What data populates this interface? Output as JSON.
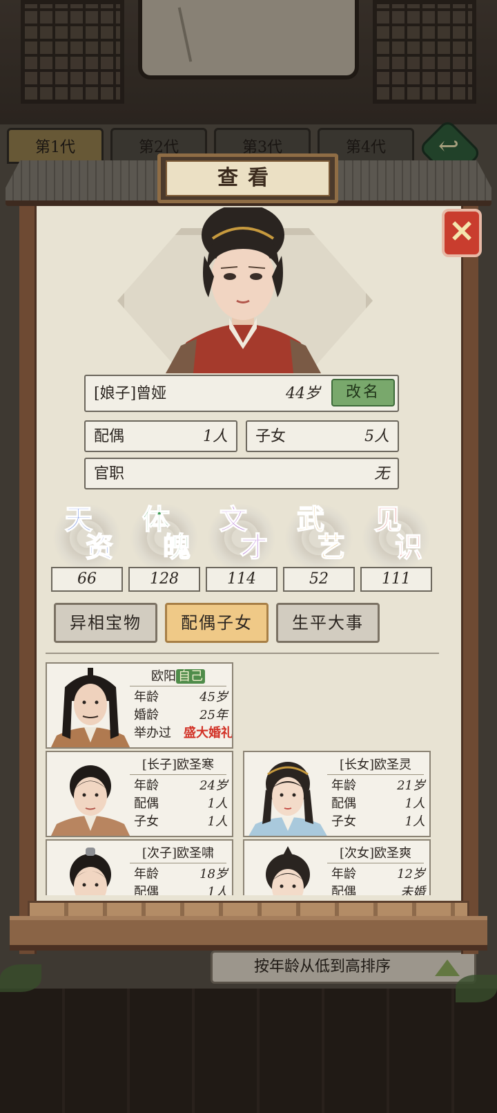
{
  "generation_tabs": [
    "第1代",
    "第2代",
    "第3代",
    "第4代"
  ],
  "sort_label": "按年龄从低到高排序",
  "dialog": {
    "title": "查看",
    "close_icon": "close-icon"
  },
  "person": {
    "name": "[娘子]曾娅",
    "age": "44岁",
    "rename_label": "改名",
    "spouse_label": "配偶",
    "spouse_value": "1人",
    "children_label": "子女",
    "children_value": "5人",
    "office_label": "官职",
    "office_value": "无"
  },
  "stats": [
    {
      "c1": "天",
      "c2": "资",
      "value": "66",
      "color": "#3a63d8"
    },
    {
      "c1": "体",
      "c2": "魄",
      "value": "128",
      "color": "#3f9a55"
    },
    {
      "c1": "文",
      "c2": "才",
      "value": "114",
      "color": "#9a48c7"
    },
    {
      "c1": "武",
      "c2": "艺",
      "value": "52",
      "color": "#d7a030"
    },
    {
      "c1": "见",
      "c2": "识",
      "value": "111",
      "color": "#d8605c"
    }
  ],
  "tabs": [
    "异相宝物",
    "配偶子女",
    "生平大事"
  ],
  "active_tab": "配偶子女",
  "members": {
    "self": {
      "surname": "欧阳",
      "self_tag": "自己",
      "rows": [
        {
          "k": "年龄",
          "v": "45岁"
        },
        {
          "k": "婚龄",
          "v": "25年"
        }
      ],
      "wedding_prefix": "举办过",
      "wedding_tag": "盛大婚礼"
    },
    "children": [
      {
        "name": "[长子]欧圣寒",
        "rows": [
          {
            "k": "年龄",
            "v": "24岁"
          },
          {
            "k": "配偶",
            "v": "1人"
          },
          {
            "k": "子女",
            "v": "1人"
          }
        ]
      },
      {
        "name": "[长女]欧圣灵",
        "rows": [
          {
            "k": "年龄",
            "v": "21岁"
          },
          {
            "k": "配偶",
            "v": "1人"
          },
          {
            "k": "子女",
            "v": "1人"
          }
        ]
      },
      {
        "name": "[次子]欧圣啸",
        "rows": [
          {
            "k": "年龄",
            "v": "18岁"
          },
          {
            "k": "配偶",
            "v": "1人"
          }
        ]
      },
      {
        "name": "[次女]欧圣爽",
        "rows": [
          {
            "k": "年龄",
            "v": "12岁"
          },
          {
            "k": "配偶",
            "v": "未婚"
          }
        ]
      }
    ]
  }
}
